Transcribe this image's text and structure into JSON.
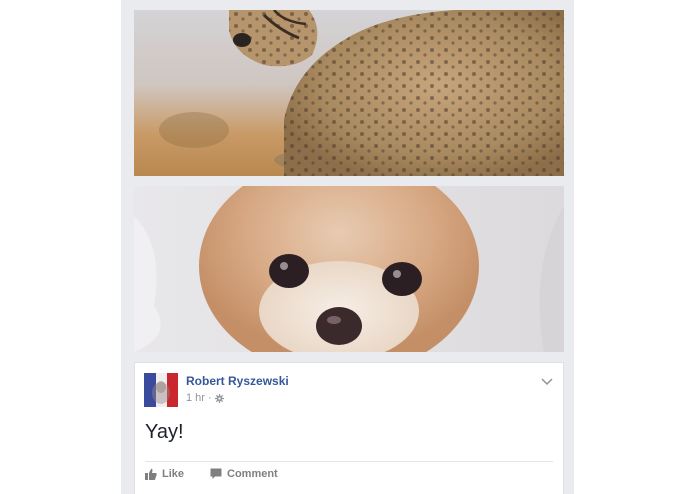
{
  "photos": [
    {
      "subject": "cheetah cub",
      "alt": ""
    },
    {
      "subject": "pomeranian dog",
      "alt": ""
    }
  ],
  "post": {
    "author": "Robert Ryszewski",
    "timestamp": "1 hr",
    "separator": "·",
    "privacy_icon": "gear-icon",
    "menu_icon": "chevron-down-icon",
    "text": "Yay!",
    "actions": {
      "like_label": "Like",
      "like_icon": "thumbs-up-icon",
      "comment_label": "Comment",
      "comment_icon": "speech-bubble-icon"
    }
  },
  "colors": {
    "feed_background": "#e9ebee",
    "author_link": "#365899",
    "meta_text": "#90949c",
    "action_text": "#7f7f7f"
  }
}
